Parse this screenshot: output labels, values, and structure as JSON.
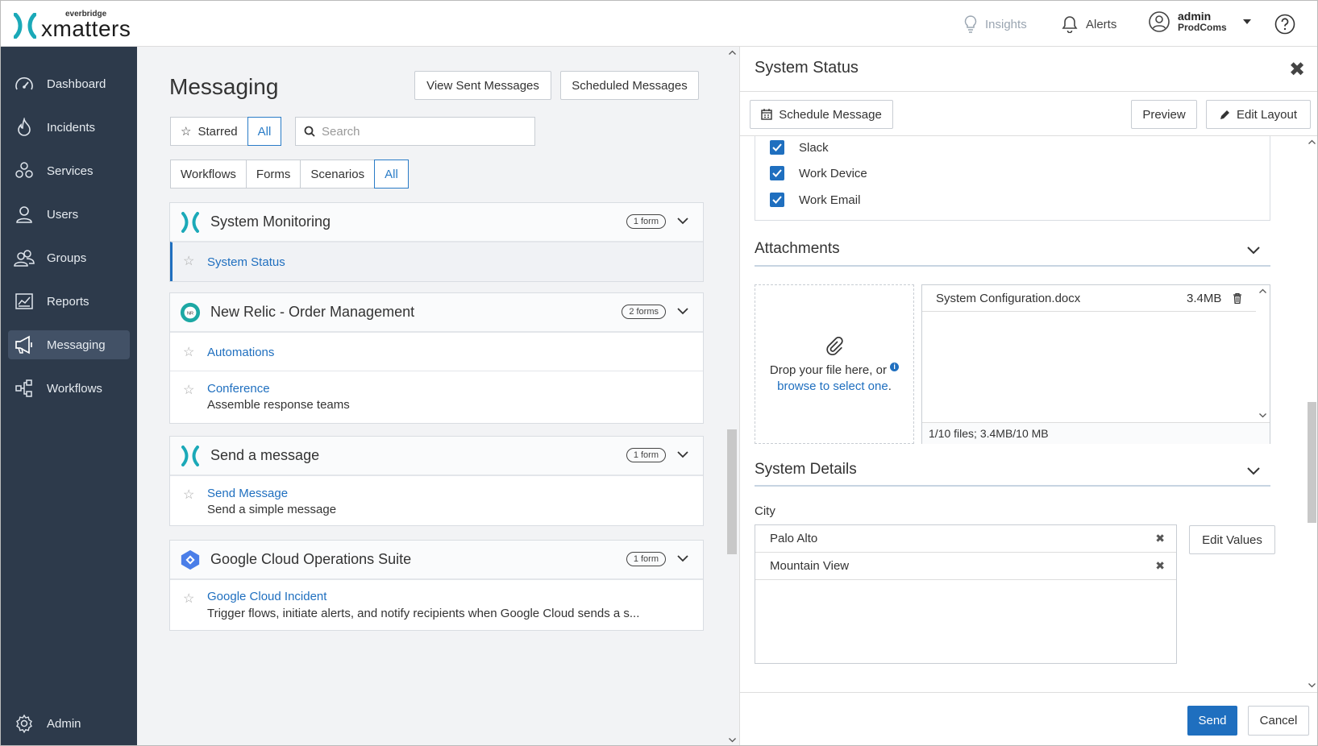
{
  "brand": {
    "small": "everbridge",
    "big": "xmatters"
  },
  "topbar": {
    "insights": "Insights",
    "alerts": "Alerts",
    "user_name": "admin",
    "user_org": "ProdComs"
  },
  "sidebar": {
    "items": [
      {
        "label": "Dashboard",
        "icon": "gauge-icon"
      },
      {
        "label": "Incidents",
        "icon": "flame-icon"
      },
      {
        "label": "Services",
        "icon": "services-icon"
      },
      {
        "label": "Users",
        "icon": "user-icon"
      },
      {
        "label": "Groups",
        "icon": "groups-icon"
      },
      {
        "label": "Reports",
        "icon": "reports-icon"
      },
      {
        "label": "Messaging",
        "icon": "megaphone-icon"
      },
      {
        "label": "Workflows",
        "icon": "workflow-icon"
      }
    ],
    "active": "Messaging",
    "admin": "Admin"
  },
  "messaging": {
    "title": "Messaging",
    "view_sent": "View Sent Messages",
    "scheduled": "Scheduled Messages",
    "filter_starred": "Starred",
    "filter_all": "All",
    "search_placeholder": "Search",
    "types": [
      "Workflows",
      "Forms",
      "Scenarios",
      "All"
    ],
    "groups": [
      {
        "title": "System Monitoring",
        "badge": "1 form",
        "forms": [
          {
            "name": "System Status",
            "desc": ""
          }
        ]
      },
      {
        "title": "New Relic - Order Management",
        "badge": "2 forms",
        "forms": [
          {
            "name": "Automations",
            "desc": ""
          },
          {
            "name": "Conference",
            "desc": "Assemble response teams"
          }
        ]
      },
      {
        "title": "Send a message",
        "badge": "1 form",
        "forms": [
          {
            "name": "Send Message",
            "desc": "Send a simple message"
          }
        ]
      },
      {
        "title": "Google Cloud Operations Suite",
        "badge": "1 form",
        "forms": [
          {
            "name": "Google Cloud Incident",
            "desc": "Trigger flows, initiate alerts, and notify recipients when Google Cloud sends a s..."
          }
        ]
      }
    ]
  },
  "panel": {
    "title": "System Status",
    "schedule_btn": "Schedule Message",
    "preview_btn": "Preview",
    "edit_layout_btn": "Edit Layout",
    "devices": [
      "Slack",
      "Work Device",
      "Work Email"
    ],
    "attachments_title": "Attachments",
    "drop_text": "Drop your file here, or",
    "drop_link": "browse to select one",
    "drop_end": ".",
    "file_name": "System Configuration.docx",
    "file_size": "3.4MB",
    "files_summary": "1/10 files; 3.4MB/10 MB",
    "details_title": "System Details",
    "city_label": "City",
    "cities": [
      "Palo Alto",
      "Mountain View"
    ],
    "edit_values": "Edit Values",
    "send": "Send",
    "cancel": "Cancel"
  },
  "colors": {
    "accent": "#1f6fbf",
    "sidebar": "#2d3a4b",
    "sidebar_active": "#425166",
    "brand_teal": "#1ba9b8"
  }
}
